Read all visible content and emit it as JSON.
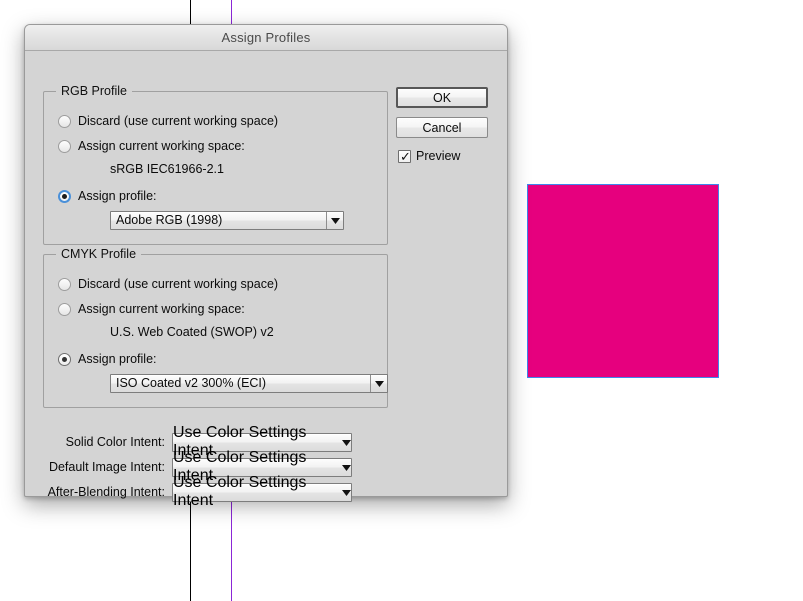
{
  "window": {
    "title": "Assign Profiles"
  },
  "buttons": {
    "ok": "OK",
    "cancel": "Cancel"
  },
  "preview": {
    "label": "Preview",
    "checked": true,
    "check_glyph": "✓"
  },
  "rgb_group": {
    "legend": "RGB Profile",
    "options": [
      {
        "label": "Discard (use current working space)",
        "selected": false
      },
      {
        "label": "Assign current working space:",
        "selected": false
      },
      {
        "label": "Assign profile:",
        "selected": true
      }
    ],
    "working_space": "sRGB IEC61966-2.1",
    "assigned_profile": "Adobe RGB (1998)"
  },
  "cmyk_group": {
    "legend": "CMYK Profile",
    "options": [
      {
        "label": "Discard (use current working space)",
        "selected": false
      },
      {
        "label": "Assign current working space:",
        "selected": false
      },
      {
        "label": "Assign profile:",
        "selected": true
      }
    ],
    "working_space": "U.S. Web Coated (SWOP) v2",
    "assigned_profile": "ISO Coated v2 300% (ECI)"
  },
  "intents": [
    {
      "label": "Solid Color Intent:",
      "value": "Use Color Settings Intent"
    },
    {
      "label": "Default Image Intent:",
      "value": "Use Color Settings Intent"
    },
    {
      "label": "After-Blending Intent:",
      "value": "Use Color Settings Intent"
    }
  ],
  "artwork": {
    "fill_color": "#e6007e",
    "selection_color": "#3f86ec"
  },
  "guides": {
    "black_color": "#000000",
    "purple_color": "#8b27d6"
  }
}
